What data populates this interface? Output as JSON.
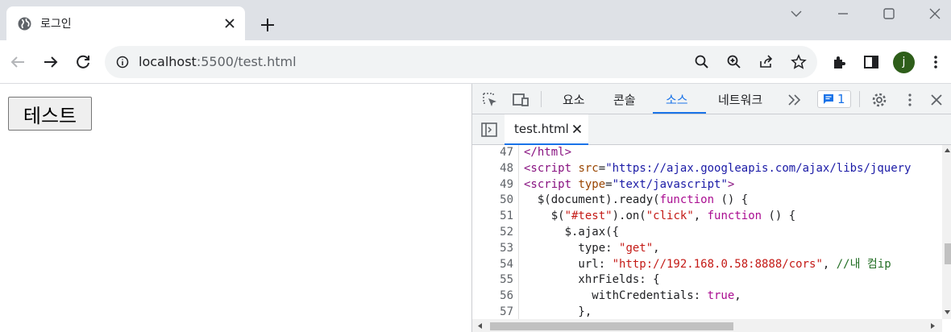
{
  "browser": {
    "tab_title": "로그인",
    "url_host": "localhost",
    "url_rest": ":5500/test.html",
    "avatar_letter": "j"
  },
  "page": {
    "button_label": "테스트"
  },
  "devtools": {
    "tabs": [
      "요소",
      "콘솔",
      "소스",
      "네트워크"
    ],
    "active_tab": "소스",
    "issues_count": "1",
    "file_tab": "test.html",
    "line_numbers": [
      "47",
      "48",
      "49",
      "50",
      "51",
      "52",
      "53",
      "54",
      "55",
      "56",
      "57"
    ],
    "code_lines": [
      "</html>",
      "<script src=\"https://ajax.googleapis.com/ajax/libs/jquery",
      "<script type=\"text/javascript\">",
      "  $(document).ready(function () {",
      "    $(\"#test\").on(\"click\", function () {",
      "      $.ajax({",
      "        type: \"get\",",
      "        url: \"http://192.168.0.58:8888/cors\", //내 컴ip",
      "        xhrFields: {",
      "          withCredentials: true,",
      "        },"
    ]
  },
  "colors": {
    "accent": "#1a73e8",
    "avatar_bg": "#2e5e1a"
  }
}
